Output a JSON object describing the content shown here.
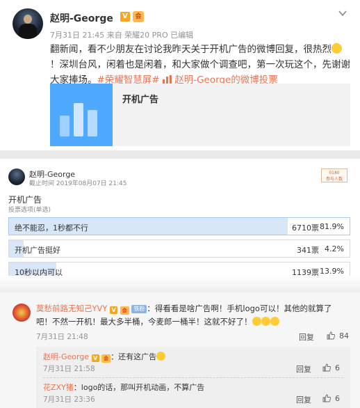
{
  "post": {
    "author": "赵明-George",
    "verify_badge": "V",
    "member_badge": "会",
    "meta": "7月31日 21:45 来自 荣耀20 PRO  已编辑",
    "text_a": "翻新闻，看不少朋友在讨论我昨天关于开机广告的微博回复，很热烈",
    "text_b": "！深圳台风，闲着也是闲着，和大家做个调查吧，第一次玩这个，先谢谢大家捧场。",
    "hashtag": "#荣耀智慧屏#",
    "poll_link": "赵明-George的微博投票",
    "card_title": "开机广告",
    "accent_color": "#eb7350"
  },
  "poll": {
    "author": "赵明-George",
    "deadline": "截止时间 2019年08月07日 21:45",
    "stamp_top": "0180",
    "stamp_bottom": "参与人数",
    "title": "开机广告",
    "subtitle": "投票选项(单选)",
    "options": [
      {
        "label": "绝不能忍，1秒都不行",
        "votes": "6710票",
        "percent": "81.9%",
        "fraction": 0.819
      },
      {
        "label": "开机广告挺好",
        "votes": "341票",
        "percent": "4.2%",
        "fraction": 0.042
      },
      {
        "label": "10秒以内可以",
        "votes": "1139票",
        "percent": "13.9%",
        "fraction": 0.139
      }
    ]
  },
  "comments": {
    "main": {
      "name": "莫愁前路无知己YVY",
      "fan_badge": "铁粉",
      "text": "：得看看是啥广告啊！手机logo可以！其他的就算了吧！不然一开机！最大多半桶，今麦郎一桶半！这就不好了！",
      "time": "7月31日 21:48",
      "reply": "回复",
      "likes": "84"
    },
    "replies": [
      {
        "name": "赵明-George",
        "text": "：还有这广告",
        "time": "7月31日 21:58",
        "reply": "回复",
        "likes": "6"
      },
      {
        "name": "花ZXY猪",
        "text": "：logo的话，那叫开机动画，不算广告",
        "time": "7月31日 23:36",
        "reply": "回复",
        "likes": "6"
      }
    ]
  }
}
